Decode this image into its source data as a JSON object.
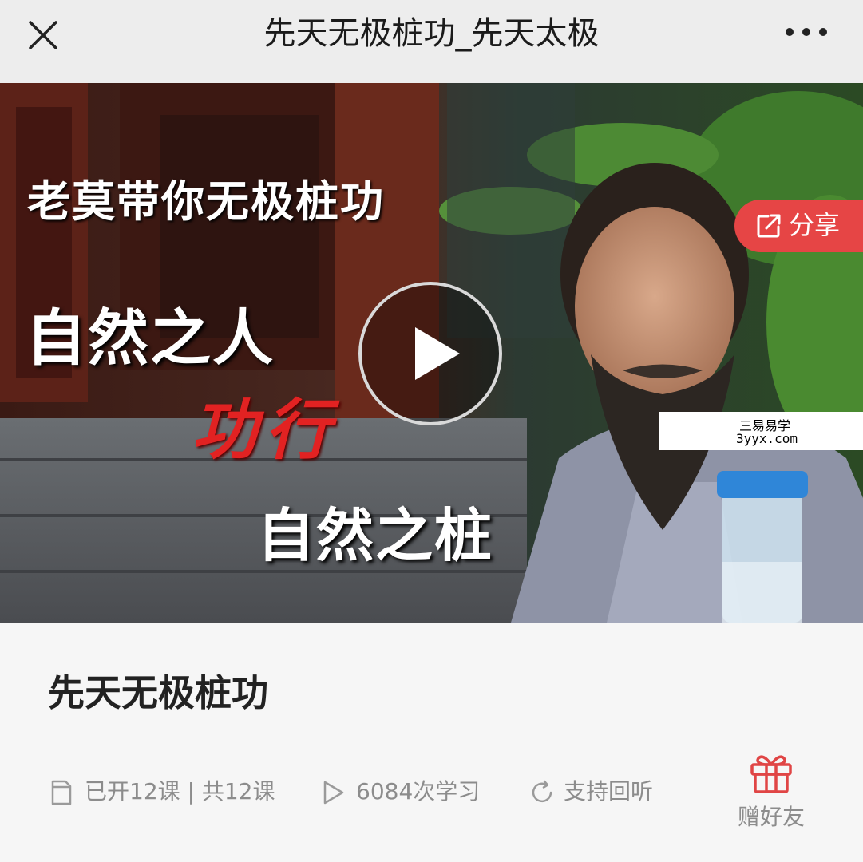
{
  "header": {
    "title": "先天无极桩功_先天太极",
    "close_icon": "close-icon",
    "more_icon": "more-horizontal-icon"
  },
  "video": {
    "overlay_line1": "老莫带你无极桩功",
    "overlay_line2": "自然之人",
    "overlay_line3": "功行",
    "overlay_line4": "自然之桩",
    "share_label": "分享",
    "share_icon": "share-icon",
    "play_icon": "play-icon",
    "watermark_line1": "三易易学",
    "watermark_line2": "3yyx.com",
    "accent_color": "#e64545"
  },
  "course": {
    "title": "先天无极桩功",
    "lessons": "已开12课 | 共12课",
    "lessons_icon": "document-icon",
    "study_count": "6084次学习",
    "study_icon": "play-outline-icon",
    "replay": "支持回听",
    "replay_icon": "refresh-icon",
    "gift_label": "赠好友",
    "gift_icon": "gift-icon"
  }
}
